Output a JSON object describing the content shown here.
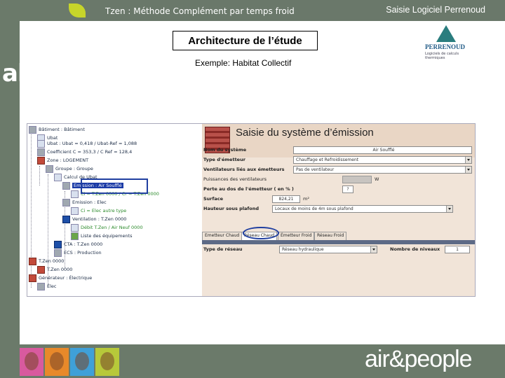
{
  "header": {
    "subtitle": "Tzen : Méthode Complément par temps froid",
    "right_title": "Saisie Logiciel Perrenoud"
  },
  "brand": {
    "left_logo": "aldes",
    "bottom_logo": "air&people",
    "perrenoud_name": "PERRENOUD",
    "perrenoud_tagline": "Logiciels de calculs thermiques",
    "colors": {
      "strip": "#6b7a6a",
      "leaf": "#c7d52a",
      "highlight": "#203fa0"
    }
  },
  "slide": {
    "title": "Architecture de l’étude",
    "example": "Exemple: Habitat Collectif"
  },
  "tree": {
    "items": [
      {
        "label": "Bâtiment : Bâtiment",
        "icon": "building-icon"
      },
      {
        "label": "Ubat",
        "icon": "ubat-icon"
      },
      {
        "label": "Ubat : Ubat = 0,418 / Ubat-Ref = 1,088",
        "icon": "ubat-icon"
      },
      {
        "label": "Coefficient C = 353,3 / C Ref = 128,4",
        "icon": "coefficient-icon"
      },
      {
        "label": "Zone : LOGEMENT",
        "icon": "zone-icon"
      },
      {
        "label": "Groupe : Groupe",
        "icon": "group-icon"
      },
      {
        "label": "Calcul de Ubat",
        "icon": "ubat-icon"
      },
      {
        "label": "Emission : Air Soufflé",
        "icon": "emission-icon"
      },
      {
        "label": "Ci = T.Zen 0000 / Cr = T.Zen 0000",
        "icon": "ci-icon"
      },
      {
        "label": "Emission : Elec",
        "icon": "emission-icon"
      },
      {
        "label": "Ci = Elec autre type",
        "icon": "ci-icon"
      },
      {
        "label": "Ventilation : T.Zen 0000",
        "icon": "ventilation-icon"
      },
      {
        "label": "Débit T.Zen / Air Neuf 0000",
        "icon": "flow-icon"
      },
      {
        "label": "Liste des équipements",
        "icon": "list-icon"
      },
      {
        "label": "CTA : T.Zen 0000",
        "icon": "cta-icon"
      },
      {
        "label": "ECS : Production",
        "icon": "ecs-icon"
      },
      {
        "label": "T.Zen 0000",
        "icon": "generator-icon"
      },
      {
        "label": "T.Zen 0000",
        "icon": "generator-icon"
      },
      {
        "label": "Générateur : Électrique",
        "icon": "generator-icon"
      },
      {
        "label": "Élec",
        "icon": "elec-icon"
      }
    ]
  },
  "panel": {
    "title": "Saisie du système d’émission",
    "fields": [
      {
        "label": "Nom du système",
        "value": "Air Soufflé"
      },
      {
        "label": "Type d'émetteur",
        "value": "Chauffage et Refroidissement"
      },
      {
        "label": "Ventilateurs liés aux émetteurs",
        "value": "Pas de ventilateur"
      },
      {
        "label": "Puissances des ventilateurs",
        "value": "",
        "unit": "W"
      },
      {
        "label": "Perte au dos de l'émetteur ( en % )",
        "value": "?"
      },
      {
        "label": "Surface",
        "value": "824,21",
        "unit": "m²"
      },
      {
        "label": "Hauteur sous plafond",
        "value": "Locaux de moins de 4m sous plafond"
      }
    ],
    "tabs": [
      "Emetteur Chaud",
      "Réseau Chaud",
      "Émetteur Froid",
      "Réseau Froid"
    ],
    "network": {
      "type_label": "Type de réseau",
      "type_value": "Réseau hydraulique",
      "levels_label": "Nombre de niveaux",
      "levels_value": "1"
    }
  }
}
